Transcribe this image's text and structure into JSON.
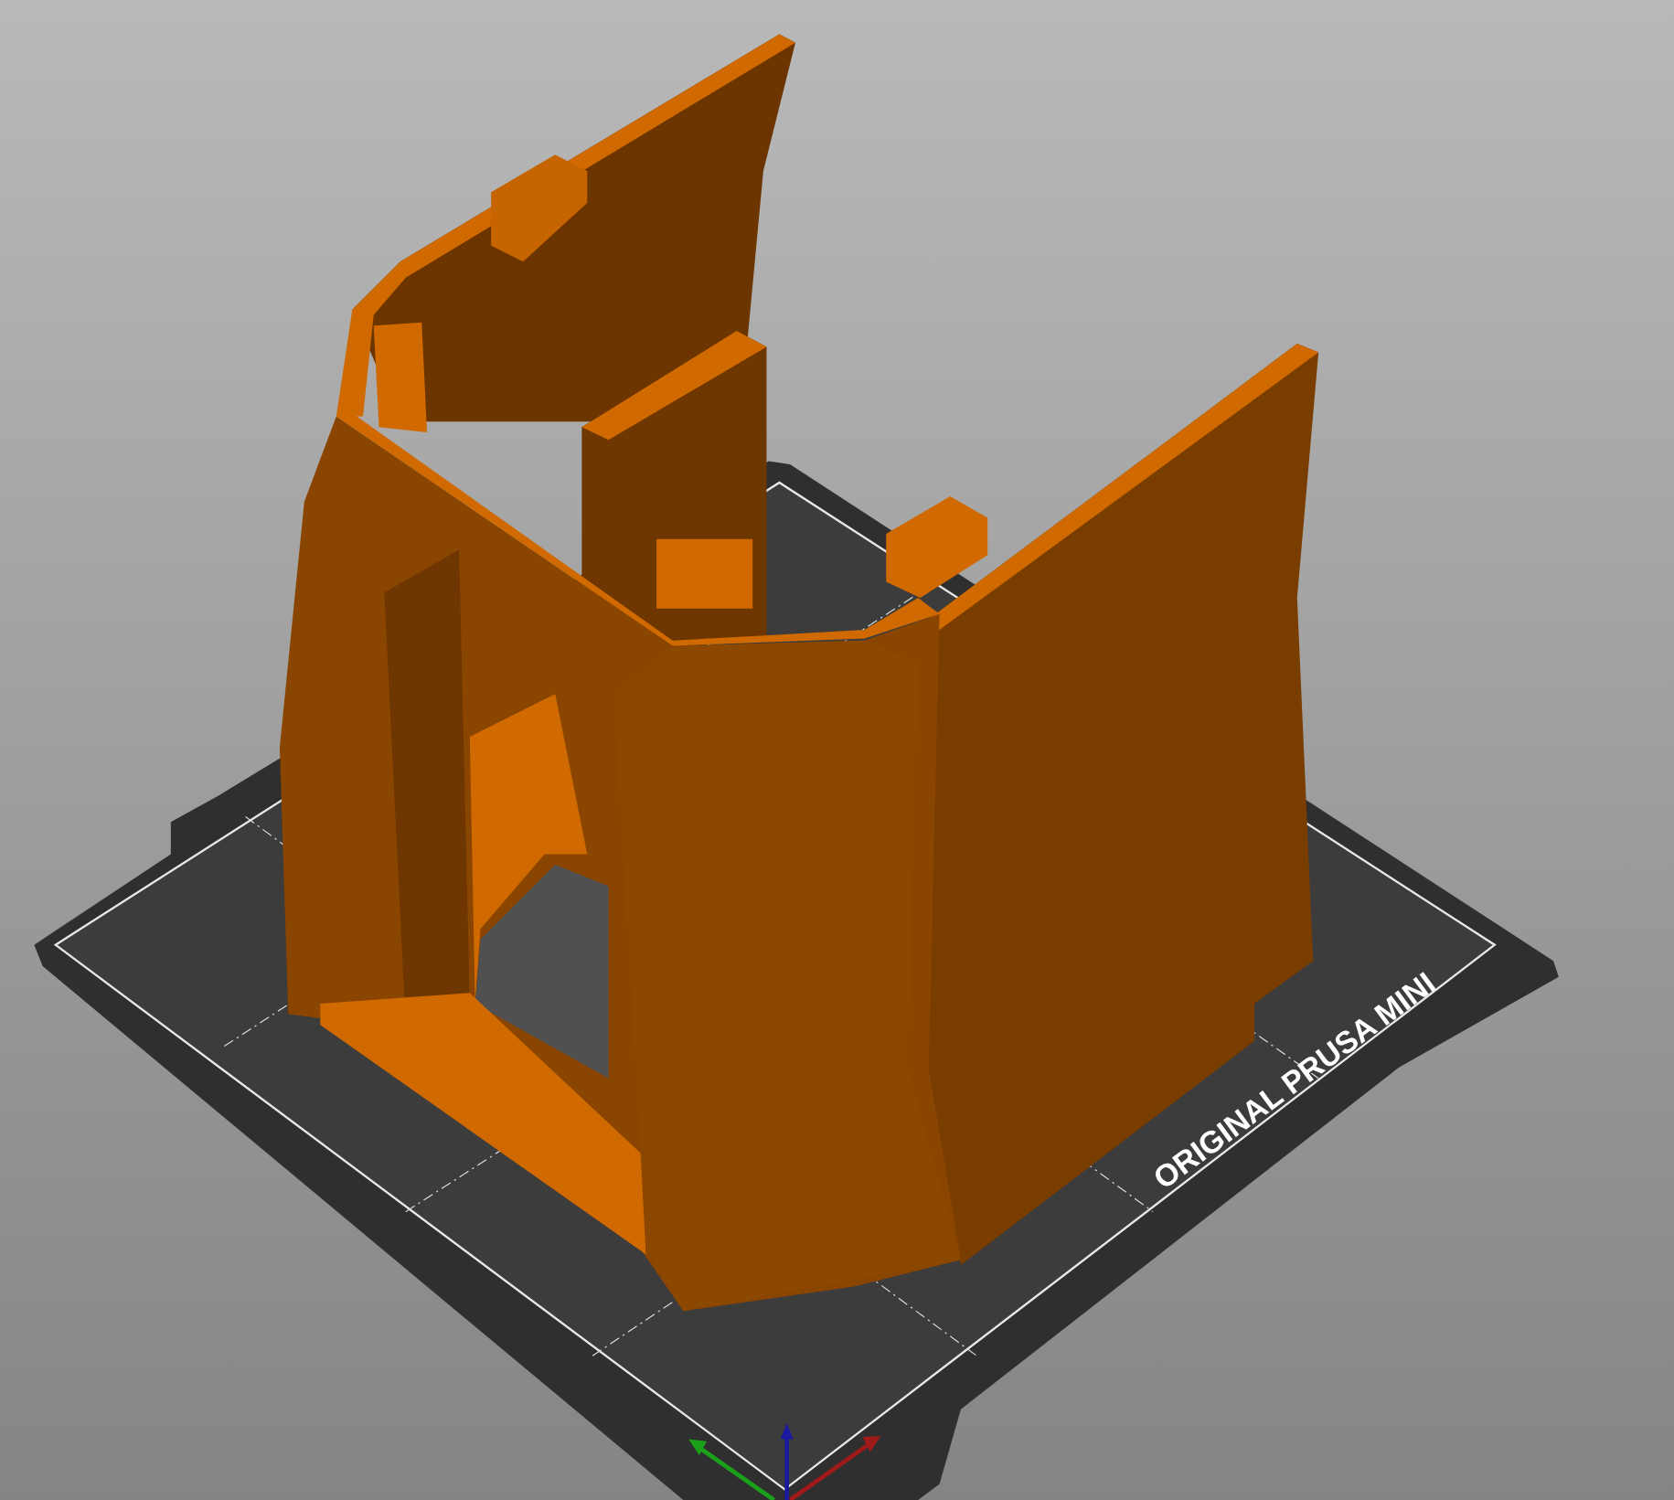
{
  "viewport": {
    "bed_label": "ORIGINAL PRUSA MINI"
  }
}
